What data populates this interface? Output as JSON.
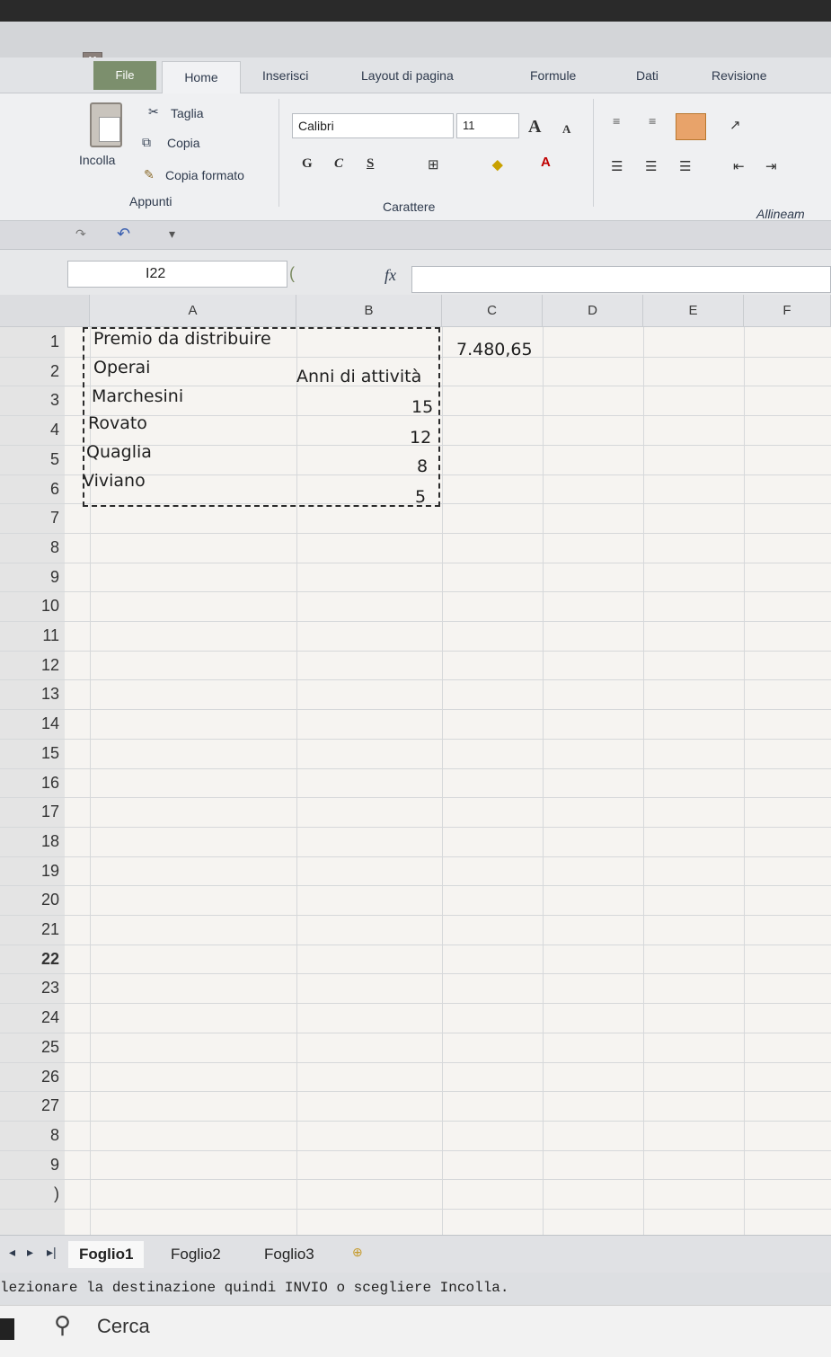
{
  "window": {
    "app_icon": "excel-icon"
  },
  "ribbon_tabs": [
    "File",
    "Home",
    "Inserisci",
    "Layout di pagina",
    "Formule",
    "Dati",
    "Revisione"
  ],
  "clipboard": {
    "paste": "Incolla",
    "cut": "Taglia",
    "copy": "Copia",
    "format_painter": "Copia formato",
    "group_label": "Appunti"
  },
  "font": {
    "name": "Calibri",
    "size": "11",
    "bold": "G",
    "italic": "C",
    "underline": "S",
    "group_label": "Carattere"
  },
  "alignment": {
    "group_label": "Allineam"
  },
  "formula_bar": {
    "name_box": "I22",
    "fx": "fx",
    "value": ""
  },
  "columns": [
    "A",
    "B",
    "C",
    "D",
    "E",
    "F"
  ],
  "rows": [
    "1",
    "2",
    "3",
    "4",
    "5",
    "6",
    "7",
    "8",
    "9",
    "10",
    "11",
    "12",
    "13",
    "14",
    "15",
    "16",
    "17",
    "18",
    "19",
    "20",
    "21",
    "22",
    "23",
    "24",
    "25",
    "26",
    "27",
    "8",
    "9",
    ")"
  ],
  "cells": {
    "A1": "Premio da distribuire",
    "C1": "7.480,65",
    "A2": "Operai",
    "B2": "Anni di attività",
    "A3": "Marchesini",
    "B3": "15",
    "A4": "Rovato",
    "B4": "12",
    "A5": "Quaglia",
    "B5": "8",
    "A6": "Viviano",
    "B6": "5"
  },
  "sheets": [
    "Foglio1",
    "Foglio2",
    "Foglio3"
  ],
  "status": "lezionare la destinazione quindi INVIO o scegliere Incolla.",
  "taskbar": {
    "search": "Cerca"
  }
}
